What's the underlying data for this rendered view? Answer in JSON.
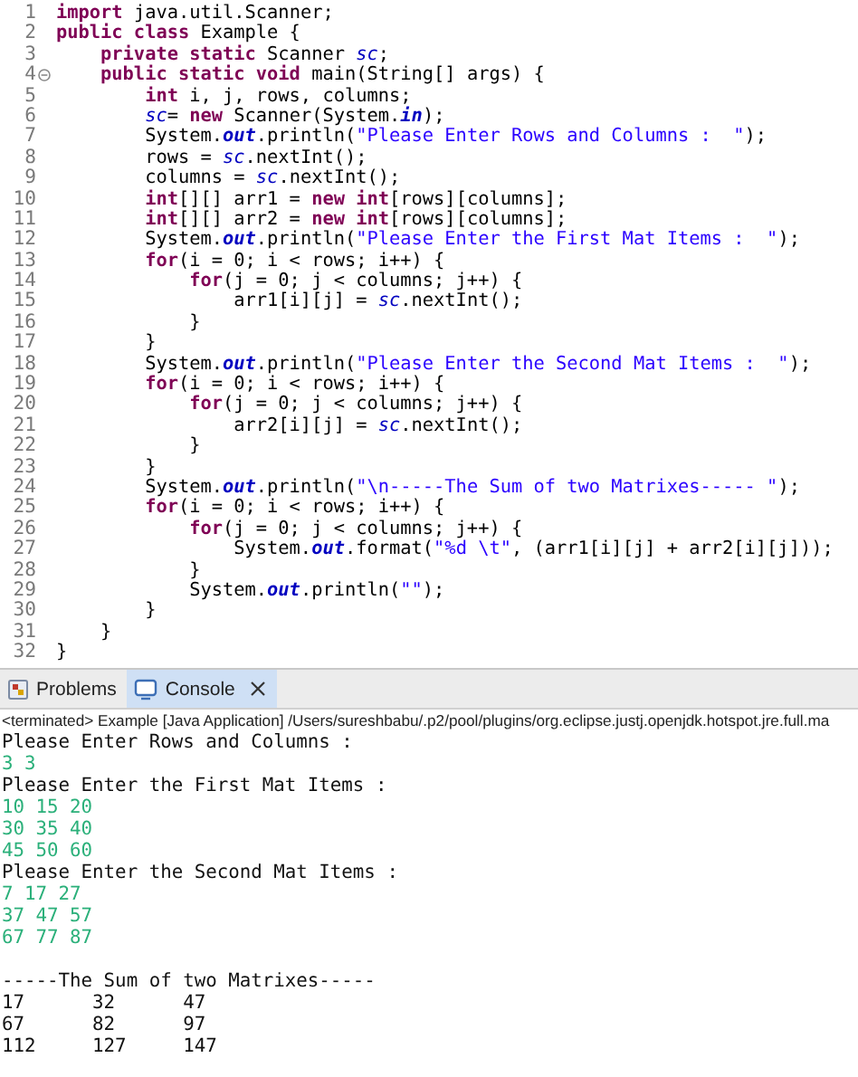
{
  "editor": {
    "lines": [
      {
        "number": "1",
        "tokens": [
          {
            "kind": "keyword",
            "text": "import"
          },
          {
            "kind": "plain",
            "text": " java.util.Scanner;"
          }
        ]
      },
      {
        "number": "2",
        "tokens": [
          {
            "kind": "keyword",
            "text": "public class"
          },
          {
            "kind": "plain",
            "text": " Example {"
          }
        ]
      },
      {
        "number": "3",
        "tokens": [
          {
            "kind": "keyword",
            "text": "private static"
          },
          {
            "kind": "plain",
            "text": " Scanner "
          },
          {
            "kind": "field",
            "text": "sc"
          },
          {
            "kind": "plain",
            "text": ";"
          }
        ]
      },
      {
        "number": "4",
        "foldable": true,
        "tokens": [
          {
            "kind": "keyword",
            "text": "public static void"
          },
          {
            "kind": "plain",
            "text": " main(String[] args) {"
          }
        ]
      },
      {
        "number": "5",
        "tokens": [
          {
            "kind": "keyword",
            "text": "int"
          },
          {
            "kind": "plain",
            "text": " i, j, rows, columns;"
          }
        ]
      },
      {
        "number": "6",
        "tokens": [
          {
            "kind": "field",
            "text": "sc"
          },
          {
            "kind": "plain",
            "text": "= "
          },
          {
            "kind": "keyword",
            "text": "new"
          },
          {
            "kind": "plain",
            "text": " Scanner(System."
          },
          {
            "kind": "static",
            "text": "in"
          },
          {
            "kind": "plain",
            "text": ");"
          }
        ]
      },
      {
        "number": "7",
        "tokens": [
          {
            "kind": "plain",
            "text": "System."
          },
          {
            "kind": "static",
            "text": "out"
          },
          {
            "kind": "plain",
            "text": ".println("
          },
          {
            "kind": "string",
            "text": "\"Please Enter Rows and Columns :  \""
          },
          {
            "kind": "plain",
            "text": ");"
          }
        ]
      },
      {
        "number": "8",
        "tokens": [
          {
            "kind": "plain",
            "text": "rows = "
          },
          {
            "kind": "field",
            "text": "sc"
          },
          {
            "kind": "plain",
            "text": ".nextInt();"
          }
        ]
      },
      {
        "number": "9",
        "tokens": [
          {
            "kind": "plain",
            "text": "columns = "
          },
          {
            "kind": "field",
            "text": "sc"
          },
          {
            "kind": "plain",
            "text": ".nextInt();"
          }
        ]
      },
      {
        "number": "10",
        "tokens": [
          {
            "kind": "keyword",
            "text": "int"
          },
          {
            "kind": "plain",
            "text": "[][] arr1 = "
          },
          {
            "kind": "keyword",
            "text": "new int"
          },
          {
            "kind": "plain",
            "text": "[rows][columns];"
          }
        ]
      },
      {
        "number": "11",
        "tokens": [
          {
            "kind": "keyword",
            "text": "int"
          },
          {
            "kind": "plain",
            "text": "[][] arr2 = "
          },
          {
            "kind": "keyword",
            "text": "new int"
          },
          {
            "kind": "plain",
            "text": "[rows][columns];"
          }
        ]
      },
      {
        "number": "12",
        "tokens": [
          {
            "kind": "plain",
            "text": "System."
          },
          {
            "kind": "static",
            "text": "out"
          },
          {
            "kind": "plain",
            "text": ".println("
          },
          {
            "kind": "string",
            "text": "\"Please Enter the First Mat Items :  \""
          },
          {
            "kind": "plain",
            "text": ");"
          }
        ]
      },
      {
        "number": "13",
        "tokens": [
          {
            "kind": "keyword",
            "text": "for"
          },
          {
            "kind": "plain",
            "text": "(i = 0; i < rows; i++) {"
          }
        ]
      },
      {
        "number": "14",
        "tokens": [
          {
            "kind": "keyword",
            "text": "for"
          },
          {
            "kind": "plain",
            "text": "(j = 0; j < columns; j++) {"
          }
        ]
      },
      {
        "number": "15",
        "tokens": [
          {
            "kind": "plain",
            "text": "arr1[i][j] = "
          },
          {
            "kind": "field",
            "text": "sc"
          },
          {
            "kind": "plain",
            "text": ".nextInt();"
          }
        ]
      },
      {
        "number": "16",
        "tokens": [
          {
            "kind": "plain",
            "text": "}"
          }
        ]
      },
      {
        "number": "17",
        "tokens": [
          {
            "kind": "plain",
            "text": "}"
          }
        ]
      },
      {
        "number": "18",
        "tokens": [
          {
            "kind": "plain",
            "text": "System."
          },
          {
            "kind": "static",
            "text": "out"
          },
          {
            "kind": "plain",
            "text": ".println("
          },
          {
            "kind": "string",
            "text": "\"Please Enter the Second Mat Items :  \""
          },
          {
            "kind": "plain",
            "text": ");"
          }
        ]
      },
      {
        "number": "19",
        "tokens": [
          {
            "kind": "keyword",
            "text": "for"
          },
          {
            "kind": "plain",
            "text": "(i = 0; i < rows; i++) {"
          }
        ]
      },
      {
        "number": "20",
        "tokens": [
          {
            "kind": "keyword",
            "text": "for"
          },
          {
            "kind": "plain",
            "text": "(j = 0; j < columns; j++) {"
          }
        ]
      },
      {
        "number": "21",
        "tokens": [
          {
            "kind": "plain",
            "text": "arr2[i][j] = "
          },
          {
            "kind": "field",
            "text": "sc"
          },
          {
            "kind": "plain",
            "text": ".nextInt();"
          }
        ]
      },
      {
        "number": "22",
        "tokens": [
          {
            "kind": "plain",
            "text": "}"
          }
        ]
      },
      {
        "number": "23",
        "tokens": [
          {
            "kind": "plain",
            "text": "}"
          }
        ]
      },
      {
        "number": "24",
        "tokens": [
          {
            "kind": "plain",
            "text": "System."
          },
          {
            "kind": "static",
            "text": "out"
          },
          {
            "kind": "plain",
            "text": ".println("
          },
          {
            "kind": "string",
            "text": "\"\\n-----The Sum of two Matrixes----- \""
          },
          {
            "kind": "plain",
            "text": ");"
          }
        ]
      },
      {
        "number": "25",
        "tokens": [
          {
            "kind": "keyword",
            "text": "for"
          },
          {
            "kind": "plain",
            "text": "(i = 0; i < rows; i++) {"
          }
        ]
      },
      {
        "number": "26",
        "tokens": [
          {
            "kind": "keyword",
            "text": "for"
          },
          {
            "kind": "plain",
            "text": "(j = 0; j < columns; j++) {"
          }
        ]
      },
      {
        "number": "27",
        "tokens": [
          {
            "kind": "plain",
            "text": "System."
          },
          {
            "kind": "static",
            "text": "out"
          },
          {
            "kind": "plain",
            "text": ".format("
          },
          {
            "kind": "string",
            "text": "\"%d \\t\""
          },
          {
            "kind": "plain",
            "text": ", (arr1[i][j] + arr2[i][j]));"
          }
        ]
      },
      {
        "number": "28",
        "tokens": [
          {
            "kind": "plain",
            "text": "}"
          }
        ]
      },
      {
        "number": "29",
        "tokens": [
          {
            "kind": "plain",
            "text": "System."
          },
          {
            "kind": "static",
            "text": "out"
          },
          {
            "kind": "plain",
            "text": ".println("
          },
          {
            "kind": "string",
            "text": "\"\""
          },
          {
            "kind": "plain",
            "text": ");"
          }
        ]
      },
      {
        "number": "30",
        "tokens": [
          {
            "kind": "plain",
            "text": "}"
          }
        ]
      },
      {
        "number": "31",
        "tokens": [
          {
            "kind": "plain",
            "text": "}"
          }
        ]
      },
      {
        "number": "32",
        "tokens": [
          {
            "kind": "plain",
            "text": "}"
          }
        ]
      }
    ]
  },
  "panel": {
    "tabs": [
      {
        "kind": "problems",
        "label": "Problems",
        "selected": false
      },
      {
        "kind": "console",
        "label": "Console",
        "selected": true,
        "closable": true
      }
    ],
    "status": "<terminated> Example [Java Application] /Users/sureshbabu/.p2/pool/plugins/org.eclipse.justj.openjdk.hotspot.jre.full.ma",
    "console_lines": [
      {
        "kind": "output",
        "text": "Please Enter Rows and Columns :"
      },
      {
        "kind": "input",
        "text": "3 3"
      },
      {
        "kind": "output",
        "text": "Please Enter the First Mat Items :"
      },
      {
        "kind": "input",
        "text": "10 15 20"
      },
      {
        "kind": "input",
        "text": "30 35 40"
      },
      {
        "kind": "input",
        "text": "45 50 60"
      },
      {
        "kind": "output",
        "text": "Please Enter the Second Mat Items :"
      },
      {
        "kind": "input",
        "text": "7 17 27"
      },
      {
        "kind": "input",
        "text": "37 47 57"
      },
      {
        "kind": "input",
        "text": "67 77 87"
      },
      {
        "kind": "blank"
      },
      {
        "kind": "output",
        "text": "-----The Sum of two Matrixes-----"
      },
      {
        "kind": "output",
        "text": "17      32      47"
      },
      {
        "kind": "output",
        "text": "67      82      97"
      },
      {
        "kind": "output",
        "text": "112     127     147"
      }
    ]
  }
}
